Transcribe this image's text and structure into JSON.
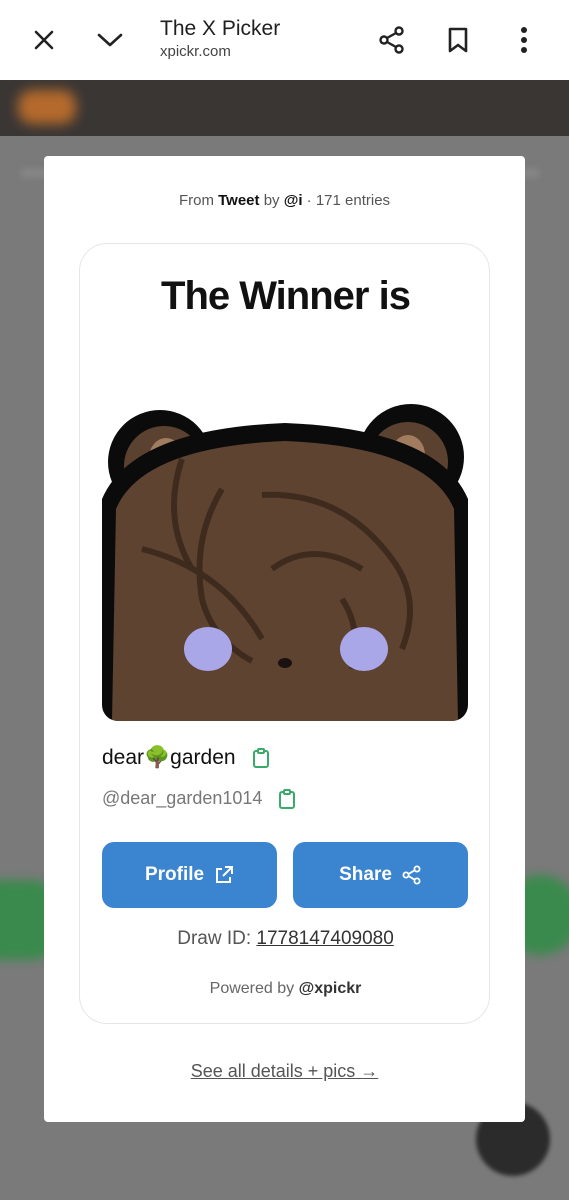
{
  "browser": {
    "title": "The X Picker",
    "url": "xpickr.com",
    "icons": [
      "close-icon",
      "chevron-down-icon",
      "share-icon",
      "bookmark-icon",
      "more-vert-icon"
    ]
  },
  "modal": {
    "from_prefix": "From",
    "from_source": "Tweet",
    "from_by": "by",
    "from_user": "@i",
    "from_entries": "· 171 entries",
    "title": "The Winner is",
    "winner": {
      "display_name": "dear🌳garden",
      "handle": "@dear_garden1014"
    },
    "buttons": {
      "profile_label": "Profile",
      "share_label": "Share"
    },
    "draw_id_label": "Draw ID:",
    "draw_id_value": "1778147409080",
    "powered_prefix": "Powered by",
    "powered_by": "@xpickr",
    "details_link": "See all details + pics →"
  },
  "colors": {
    "primary_button": "#3a84d0",
    "copy_icon": "#3aaa6a",
    "avatar_fur": "#5e4331",
    "avatar_cheek": "#a9a7e8"
  }
}
